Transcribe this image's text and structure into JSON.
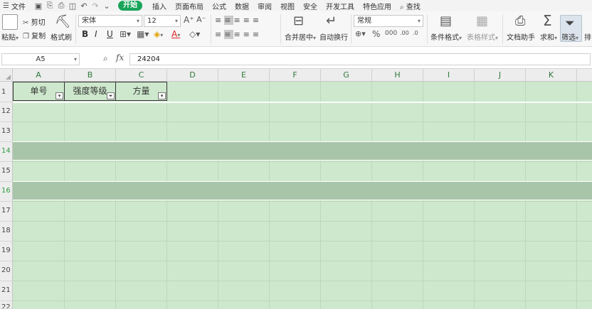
{
  "menu": {
    "file": "文件",
    "start": "开始",
    "tabs": [
      "插入",
      "页面布局",
      "公式",
      "数据",
      "审阅",
      "视图",
      "安全",
      "开发工具",
      "特色应用"
    ],
    "search": "查找"
  },
  "ribbon": {
    "paste": "粘贴",
    "cut": "剪切",
    "copy": "复制",
    "format_painter": "格式刷",
    "font_name": "宋体",
    "font_size": "12",
    "bold": "B",
    "italic": "I",
    "underline": "U",
    "merge_center": "合并居中",
    "wrap": "自动换行",
    "number_format": "常规",
    "cond_format": "条件格式",
    "table_style": "表格样式",
    "doc_helper": "文档助手",
    "sum": "求和",
    "filter": "筛选",
    "sort": "排"
  },
  "formula_bar": {
    "cell_ref": "A5",
    "fx": "fx",
    "value": "24204"
  },
  "sheet": {
    "columns": [
      "A",
      "B",
      "C",
      "D",
      "E",
      "F",
      "G",
      "H",
      "I",
      "J",
      "K"
    ],
    "rows": [
      "1",
      "12",
      "13",
      "14",
      "15",
      "16",
      "17",
      "18",
      "19",
      "20",
      "21",
      "22"
    ],
    "headers": [
      "单号",
      "强度等级",
      "方量"
    ]
  },
  "colors": {
    "sheet_bg": "#cde8cc",
    "selected_row": "#a9c5a9",
    "start_tab": "#1aa45a"
  }
}
